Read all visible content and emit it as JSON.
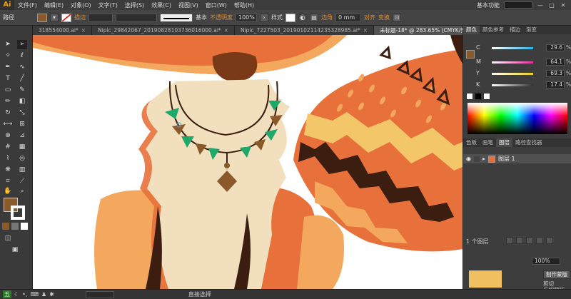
{
  "app": {
    "logo": "Ai"
  },
  "menu": {
    "items": [
      "文件(F)",
      "编辑(E)",
      "对象(O)",
      "文字(T)",
      "选择(S)",
      "效果(C)",
      "视图(V)",
      "窗口(W)",
      "帮助(H)"
    ],
    "workspace": "基本功能",
    "window_buttons": [
      "—",
      "□",
      "✕"
    ]
  },
  "control": {
    "mode_label": "路径",
    "fill_color": "#8b5a2b",
    "stroke_label": "描边",
    "stroke_style": "基本",
    "opacity_label": "不透明度",
    "opacity_value": "100%",
    "style_label": "样式",
    "corner_label": "边角",
    "corner_value": "0 mm",
    "align_label": "对齐",
    "transform_label": "变换"
  },
  "tabs": [
    {
      "label": "318554000.ai*",
      "active": false
    },
    {
      "label": "Nipic_29842067_20190828103736016000.ai*",
      "active": false
    },
    {
      "label": "Nipic_7227503_20190102114235328985.ai*",
      "active": false
    },
    {
      "label": "未标题-18* @ 283.65% (CMYK/预览)",
      "active": true
    }
  ],
  "toolbar": {
    "fill_color": "#8b5a2b"
  },
  "color_panel": {
    "tabs": [
      "颜色",
      "颜色参考",
      "描边",
      "渐变"
    ],
    "channels": [
      {
        "label": "C",
        "value": "29.6",
        "color": "#2ab1e0"
      },
      {
        "label": "M",
        "value": "64.1",
        "color": "#e0309a"
      },
      {
        "label": "Y",
        "value": "69.3",
        "color": "#e8d020"
      },
      {
        "label": "K",
        "value": "17.4",
        "color": "#333333"
      }
    ],
    "percent": "%"
  },
  "layers_panel": {
    "tabs": [
      "色板",
      "画笔",
      "图层",
      "路径查找器"
    ],
    "layer_name": "图层 1",
    "layer_count": "1 个图层"
  },
  "transparency_panel": {
    "opacity_value": "100%",
    "make_mask": "制作蒙版",
    "clip": "剪切",
    "invert_mask": "反相蒙版"
  },
  "status": {
    "ime": "五",
    "mode": "直接选择"
  },
  "artwork_colors": {
    "fox_orange": "#e8703a",
    "fox_light": "#f4a85e",
    "cream": "#f2dfbd",
    "dark_brown": "#3b1e0f",
    "nose": "#7a3a18",
    "teal": "#1ea86a",
    "yellow": "#f4c66a"
  }
}
